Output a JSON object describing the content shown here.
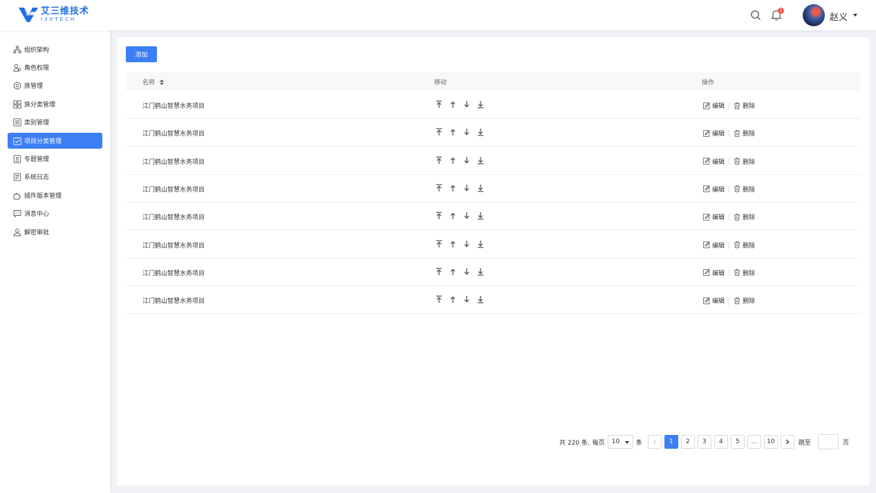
{
  "header": {
    "brand_cn": "艾三维技术",
    "brand_en": "I3VTECH",
    "notification_count": "1",
    "user_name": "赵义"
  },
  "sidebar": {
    "items": [
      {
        "label": "组织架构",
        "icon": "org-chart-icon"
      },
      {
        "label": "角色权限",
        "icon": "users-icon"
      },
      {
        "label": "族管理",
        "icon": "gear-icon"
      },
      {
        "label": "族分类管理",
        "icon": "grid-icon"
      },
      {
        "label": "类别管理",
        "icon": "list-icon"
      },
      {
        "label": "项目分类管理",
        "icon": "check-square-icon",
        "active": true
      },
      {
        "label": "专题管理",
        "icon": "topic-icon"
      },
      {
        "label": "系统日志",
        "icon": "log-icon"
      },
      {
        "label": "插件版本管理",
        "icon": "puzzle-icon"
      },
      {
        "label": "消息中心",
        "icon": "message-icon"
      },
      {
        "label": "解密审批",
        "icon": "user-approve-icon"
      }
    ]
  },
  "toolbar": {
    "add_label": "添加"
  },
  "table": {
    "headers": {
      "name": "名称",
      "move": "移动",
      "actions": "操作"
    },
    "rows": [
      {
        "name": "江门鹤山智慧水务项目"
      },
      {
        "name": "江门鹤山智慧水务项目"
      },
      {
        "name": "江门鹤山智慧水务项目"
      },
      {
        "name": "江门鹤山智慧水务项目"
      },
      {
        "name": "江门鹤山智慧水务项目"
      },
      {
        "name": "江门鹤山智慧水务项目"
      },
      {
        "name": "江门鹤山智慧水务项目"
      },
      {
        "name": "江门鹤山智慧水务项目"
      }
    ],
    "edit_label": "编辑",
    "delete_label": "删除"
  },
  "pagination": {
    "total_text": "共 220 条,",
    "per_page_label": "每页",
    "page_size": "10",
    "unit_label": "条",
    "pages": [
      "1",
      "2",
      "3",
      "4",
      "5",
      "...",
      "10"
    ],
    "current_page": "1",
    "jump_label": "跳至",
    "page_suffix": "页"
  },
  "colors": {
    "accent": "#3c7ef5",
    "badge": "#f5514b"
  }
}
